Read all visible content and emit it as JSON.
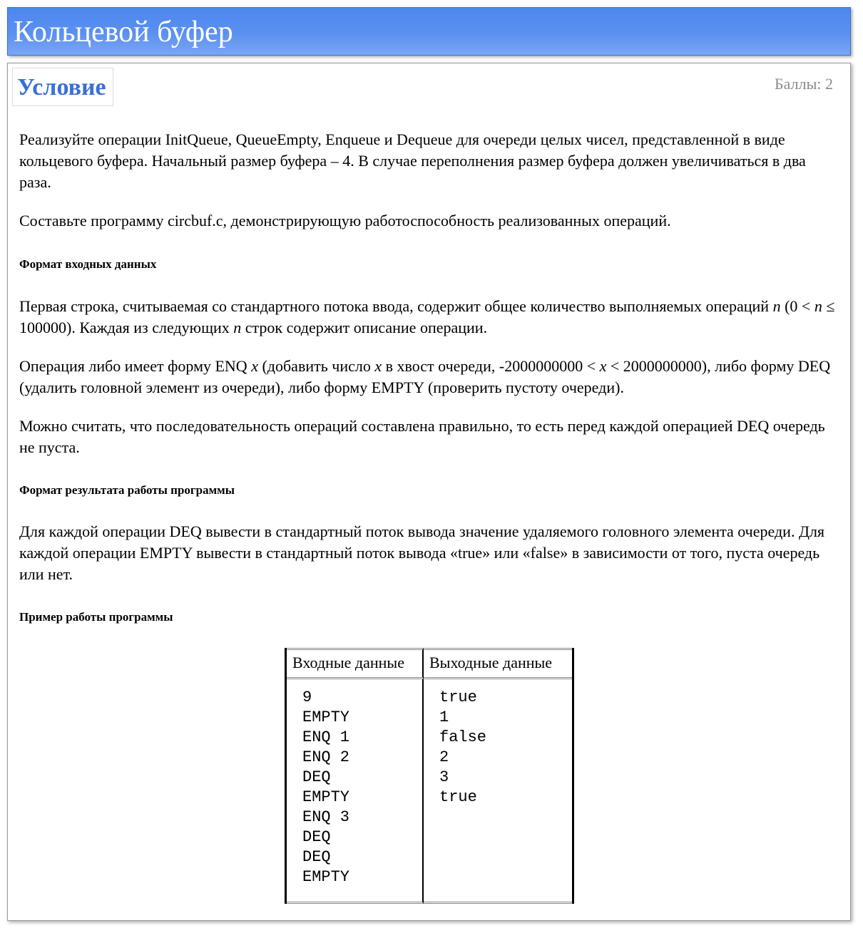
{
  "window": {
    "title": "Кольцевой буфер"
  },
  "condition": {
    "heading": "Условие",
    "score": "Баллы: 2"
  },
  "statement": {
    "p1": "Реализуйте операции InitQueue, QueueEmpty, Enqueue и Dequeue для очереди целых чисел, представленной в виде кольцевого буфера. Начальный размер буфера – 4. В случае переполнения размер буфера должен увеличиваться в два раза.",
    "p2": "Составьте программу circbuf.c, демонстрирующую работоспособность реализованных операций."
  },
  "input_format": {
    "heading": "Формат входных данных",
    "p1_a": "Первая строка, считываемая со стандартного потока ввода, содержит общее количество выполняемых операций",
    "p1_n1": "n",
    "p1_b": " (0 < ",
    "p1_n2": "n",
    "p1_c": " ≤ 100000). Каждая из следующих ",
    "p1_n3": "n",
    "p1_d": " строк содержит описание операции.",
    "p2_a": "Операция либо имеет форму ENQ ",
    "p2_x1": "x",
    "p2_b": " (добавить число ",
    "p2_x2": "x",
    "p2_c": " в хвост очереди, -2000000000 < ",
    "p2_x3": "x",
    "p2_d": " < 2000000000), либо форму DEQ (удалить головной элемент из очереди), либо форму EMPTY (проверить пустоту очереди).",
    "p3": "Можно считать, что последовательность операций составлена правильно, то есть перед каждой операцией DEQ очередь не пуста."
  },
  "output_format": {
    "heading": "Формат результата работы программы",
    "p1": "Для каждой операции DEQ вывести в стандартный поток вывода значение удаляемого головного элемента очереди. Для каждой операции EMPTY вывести в стандартный поток вывода «true» или «false» в зависимости от того, пуста очередь или нет."
  },
  "example": {
    "heading": "Пример работы программы",
    "input_header": "Входные данные",
    "output_header": "Выходные данные",
    "input_lines": [
      "9",
      "EMPTY",
      "ENQ 1",
      "ENQ 2",
      "DEQ",
      "EMPTY",
      "ENQ 3",
      "DEQ",
      "DEQ",
      "EMPTY"
    ],
    "output_lines": [
      "true",
      "1",
      "false",
      "2",
      "3",
      "true"
    ]
  }
}
